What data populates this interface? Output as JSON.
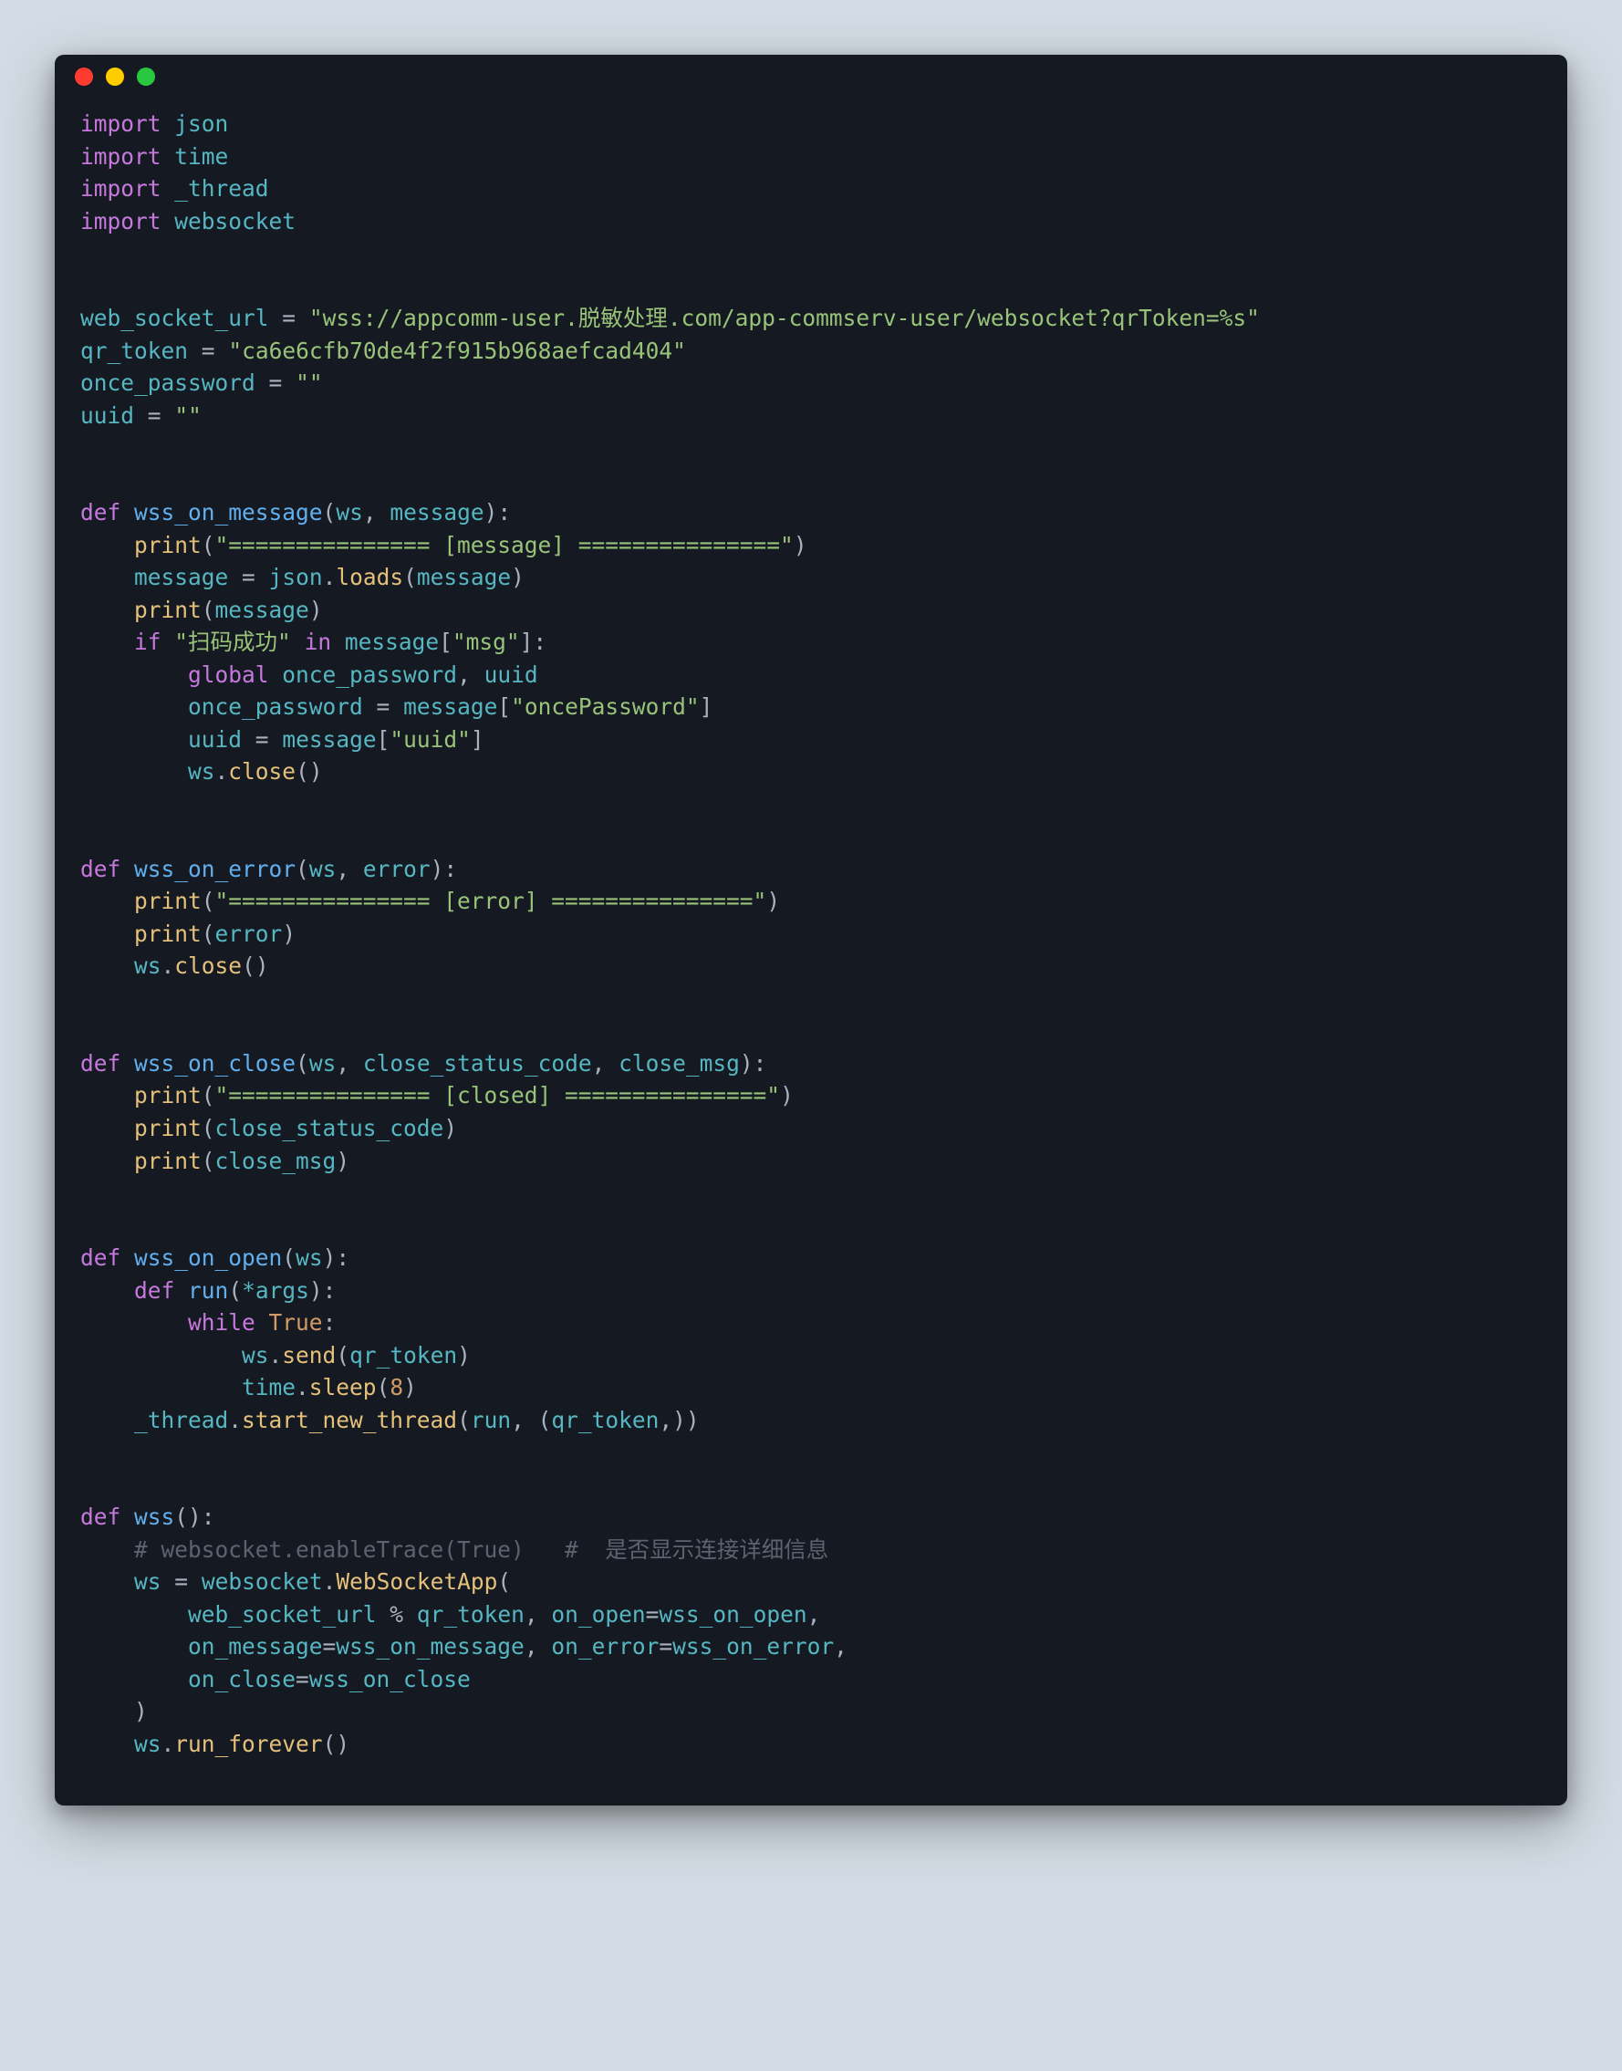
{
  "window": {
    "dots": [
      "red",
      "yellow",
      "green"
    ]
  },
  "code": {
    "imports": {
      "kw": "import",
      "mods": [
        "json",
        "time",
        "_thread",
        "websocket"
      ]
    },
    "assigns": {
      "web_socket_url_name": "web_socket_url",
      "web_socket_url_val": "\"wss://appcomm-user.脱敏处理.com/app-commserv-user/websocket?qrToken=%s\"",
      "qr_token_name": "qr_token",
      "qr_token_val": "\"ca6e6cfb70de4f2f915b968aefcad404\"",
      "once_password_name": "once_password",
      "once_password_val": "\"\"",
      "uuid_name": "uuid",
      "uuid_val": "\"\""
    },
    "defs": {
      "def_kw": "def",
      "on_message": {
        "name": "wss_on_message",
        "params_ws": "ws",
        "params_message": "message",
        "print1": "\"=============== [message] ===============\"",
        "assign_msg_left": "message",
        "json": "json",
        "loads": "loads",
        "loads_arg": "message",
        "print2_arg": "message",
        "if_kw": "if",
        "if_str": "\"扫码成功\"",
        "in_kw": "in",
        "msg_key": "\"msg\"",
        "global_kw": "global",
        "global_a": "once_password",
        "global_b": "uuid",
        "once_password": "once_password",
        "once_key": "\"oncePassword\"",
        "uuid": "uuid",
        "uuid_key": "\"uuid\"",
        "ws": "ws",
        "close": "close"
      },
      "on_error": {
        "name": "wss_on_error",
        "params_ws": "ws",
        "params_error": "error",
        "print1": "\"=============== [error] ===============\"",
        "print2_arg": "error",
        "ws": "ws",
        "close": "close"
      },
      "on_close": {
        "name": "wss_on_close",
        "params_ws": "ws",
        "params_code": "close_status_code",
        "params_msg": "close_msg",
        "print1": "\"=============== [closed] ===============\"",
        "print2_arg": "close_status_code",
        "print3_arg": "close_msg"
      },
      "on_open": {
        "name": "wss_on_open",
        "params_ws": "ws",
        "run_name": "run",
        "run_args": "*args",
        "while_kw": "while",
        "true": "True",
        "ws": "ws",
        "send": "send",
        "send_arg": "qr_token",
        "time": "time",
        "sleep": "sleep",
        "sleep_arg": "8",
        "thread": "_thread",
        "start_new_thread": "start_new_thread",
        "snt_arg1": "run",
        "snt_arg2": "qr_token"
      },
      "wss": {
        "name": "wss",
        "comment": "# websocket.enableTrace(True)   #  是否显示连接详细信息",
        "ws": "ws",
        "websocket": "websocket",
        "WebSocketApp": "WebSocketApp",
        "arg_url_left": "web_socket_url",
        "pct": "%",
        "arg_url_right": "qr_token",
        "on_open_k": "on_open",
        "on_open_v": "wss_on_open",
        "on_message_k": "on_message",
        "on_message_v": "wss_on_message",
        "on_error_k": "on_error",
        "on_error_v": "wss_on_error",
        "on_close_k": "on_close",
        "on_close_v": "wss_on_close",
        "run_forever": "run_forever"
      }
    },
    "print_name": "print"
  }
}
